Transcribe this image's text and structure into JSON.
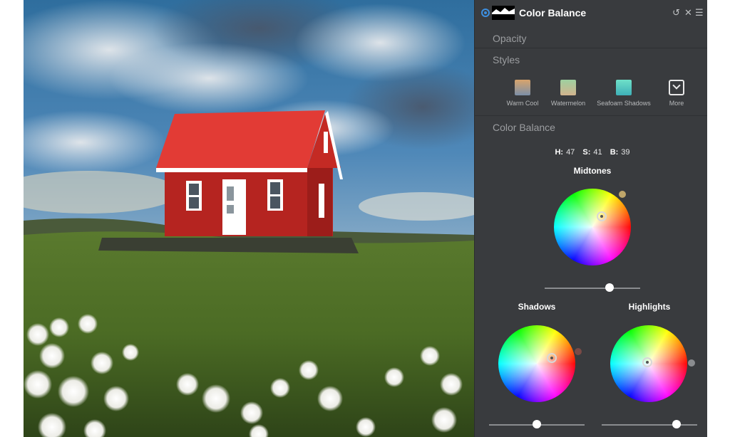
{
  "panel": {
    "title": "Color Balance",
    "icons": {
      "enable": "radio-dot-icon",
      "thumb": "mountain-thumbnail-icon",
      "reset": "undo-icon",
      "close": "close-icon",
      "menu": "hamburger-menu-icon"
    },
    "sections": {
      "opacity": "Opacity",
      "styles": "Styles",
      "color_balance": "Color Balance"
    },
    "styles": [
      {
        "label": "Warm Cool",
        "color_top": "#d8a46c",
        "color_bottom": "#7b8fa8"
      },
      {
        "label": "Watermelon",
        "color_top": "#9ed0a0",
        "color_bottom": "#d2b48e"
      },
      {
        "label": "Seafoam Shadows",
        "color_top": "#6fe0c8",
        "color_bottom": "#3eb0b8"
      },
      {
        "label": "More"
      }
    ],
    "hsb": {
      "h_label": "H:",
      "h": "47",
      "s_label": "S:",
      "s": "41",
      "b_label": "B:",
      "b": "39"
    },
    "wheels": {
      "midtones": {
        "title": "Midtones",
        "indicator_color": "#bfa66a",
        "slider_value": 0.68
      },
      "shadows": {
        "title": "Shadows",
        "indicator_color": "#7a4a46",
        "slider_value": 0.5
      },
      "highlights": {
        "title": "Highlights",
        "indicator_color": "#8a8c8f",
        "slider_value": 0.78
      }
    }
  }
}
